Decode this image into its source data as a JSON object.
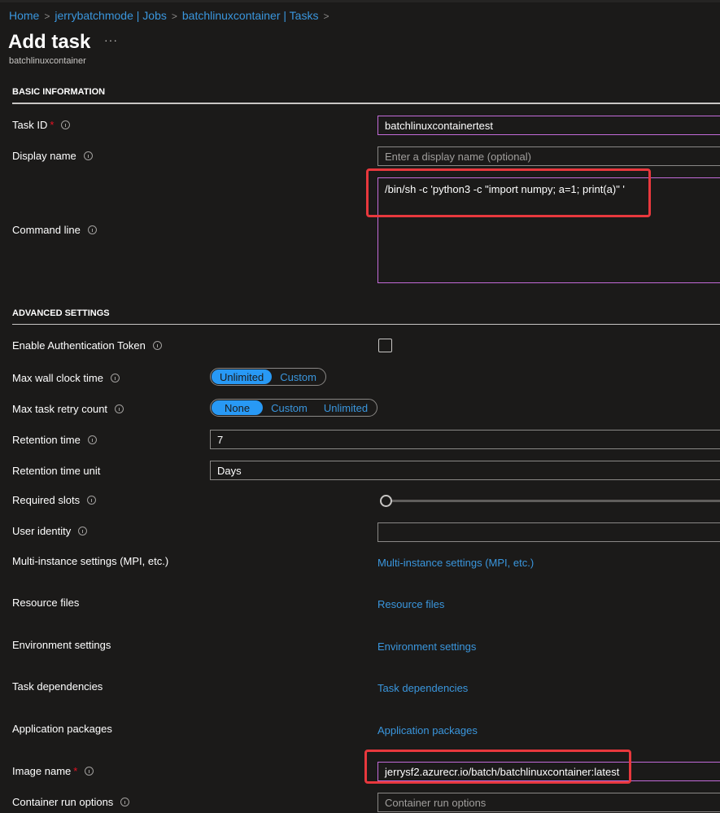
{
  "breadcrumb": [
    {
      "label": "Home"
    },
    {
      "label": "jerrybatchmode | Jobs"
    },
    {
      "label": "batchlinuxcontainer | Tasks"
    }
  ],
  "breadcrumb_separator": ">",
  "page": {
    "title": "Add task",
    "more_label": "···",
    "subtitle": "batchlinuxcontainer"
  },
  "basic": {
    "section_title": "BASIC INFORMATION",
    "task_id": {
      "label": "Task ID",
      "required": "*",
      "value": "batchlinuxcontainertest"
    },
    "display_name": {
      "label": "Display name",
      "placeholder": "Enter a display name (optional)"
    },
    "command_line": {
      "label": "Command line",
      "value": "/bin/sh -c 'python3 -c \"import numpy; a=1; print(a)\" '"
    }
  },
  "advanced": {
    "section_title": "ADVANCED SETTINGS",
    "auth_token": {
      "label": "Enable Authentication Token",
      "checked": false
    },
    "max_wall_clock": {
      "label": "Max wall clock time",
      "options": [
        "Unlimited",
        "Custom"
      ],
      "selected": "Unlimited"
    },
    "max_retry": {
      "label": "Max task retry count",
      "options": [
        "None",
        "Custom",
        "Unlimited"
      ],
      "selected": "None"
    },
    "retention_time": {
      "label": "Retention time",
      "value": "7"
    },
    "retention_unit": {
      "label": "Retention time unit",
      "value": "Days"
    },
    "required_slots": {
      "label": "Required slots",
      "slider_position": 0
    },
    "user_identity": {
      "label": "User identity",
      "value": ""
    },
    "multi_instance": {
      "label": "Multi-instance settings (MPI, etc.)",
      "link": "Multi-instance settings (MPI, etc.)"
    },
    "resource_files": {
      "label": "Resource files",
      "link": "Resource files"
    },
    "environment": {
      "label": "Environment settings",
      "link": "Environment settings"
    },
    "dependencies": {
      "label": "Task dependencies",
      "link": "Task dependencies"
    },
    "app_packages": {
      "label": "Application packages",
      "link": "Application packages"
    },
    "image_name": {
      "label": "Image name",
      "required": "*",
      "value": "jerrysf2.azurecr.io/batch/batchlinuxcontainer:latest"
    },
    "container_options": {
      "label": "Container run options",
      "placeholder": "Container run options"
    }
  },
  "colors": {
    "accent": "#2899f5",
    "link": "#3a96dd",
    "highlight": "#e8383d",
    "focus_border": "#c36bd9",
    "background": "#1b1a19"
  }
}
